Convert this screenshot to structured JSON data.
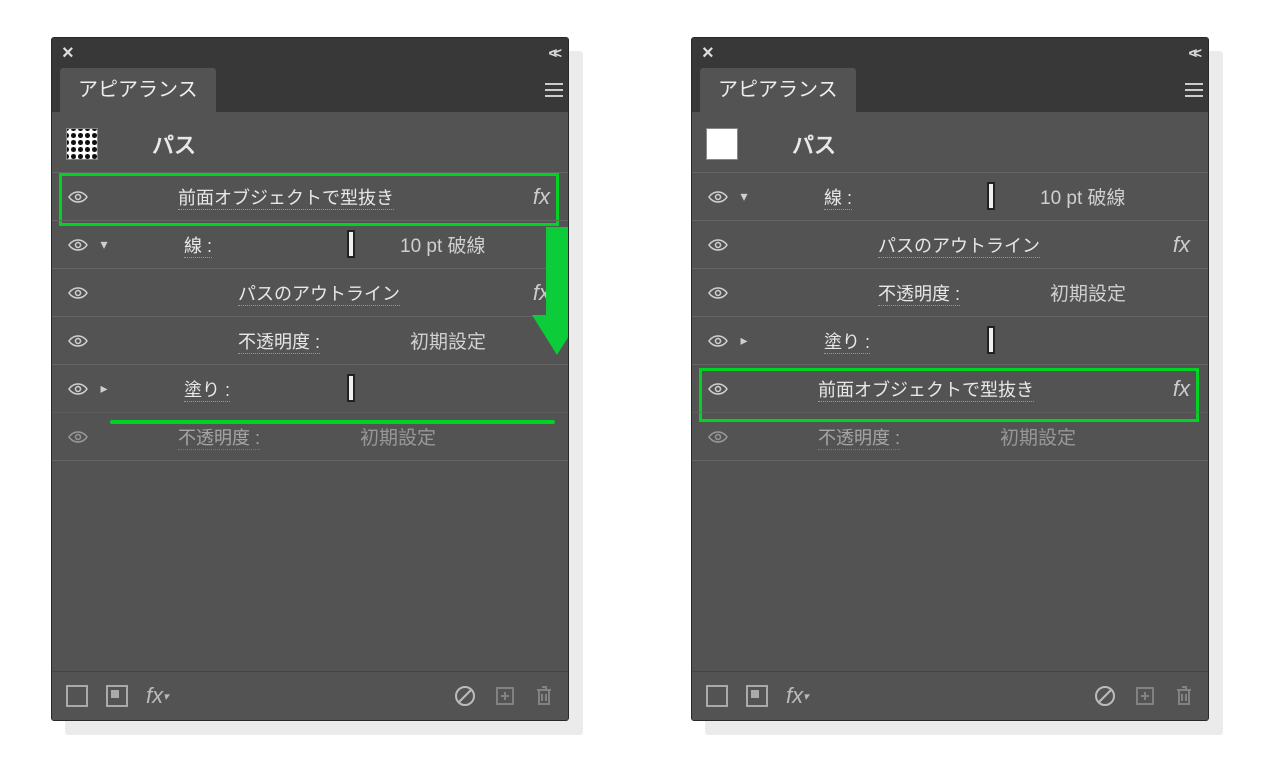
{
  "left": {
    "title": "アピアランス",
    "sel_label": "パス",
    "knockout": "前面オブジェクトで型抜き",
    "stroke_label": "線 :",
    "stroke_value": "10 pt 破線",
    "outline": "パスのアウトライン",
    "opacity_label": "不透明度 :",
    "opacity_value": "初期設定",
    "fill_label": "塗り :",
    "opacity2_label": "不透明度 :",
    "opacity2_value": "初期設定"
  },
  "right": {
    "title": "アピアランス",
    "sel_label": "パス",
    "stroke_label": "線 :",
    "stroke_value": "10 pt 破線",
    "outline": "パスのアウトライン",
    "opacity_label": "不透明度 :",
    "opacity_value": "初期設定",
    "fill_label": "塗り :",
    "knockout": "前面オブジェクトで型抜き",
    "opacity2_label": "不透明度 :",
    "opacity2_value": "初期設定"
  },
  "fx_glyph": "fx"
}
